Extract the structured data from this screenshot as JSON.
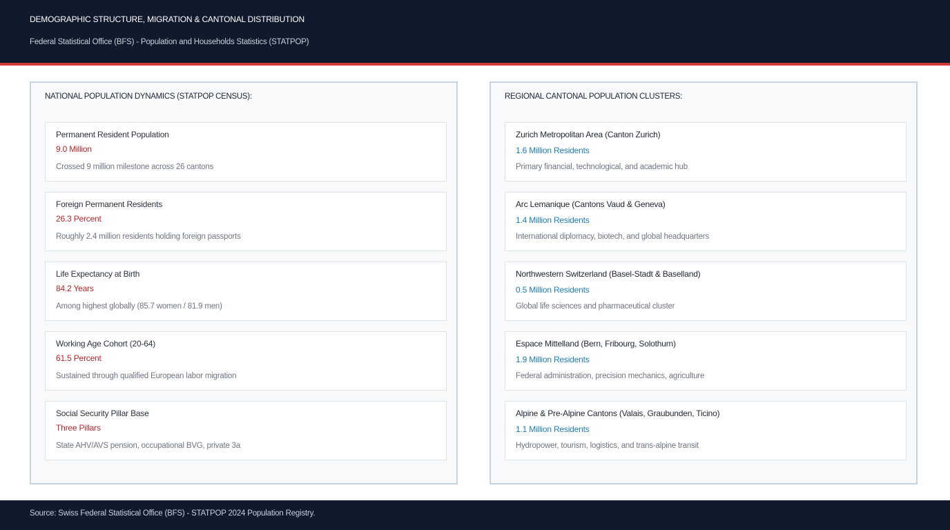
{
  "header": {
    "title": "DEMOGRAPHIC STRUCTURE, MIGRATION & CANTONAL DISTRIBUTION",
    "subtitle": "Federal Statistical Office (BFS) - Population and Households Statistics (STATPOP)"
  },
  "colors": {
    "header_bg": "#111a2c",
    "accent_red": "#d33a3a",
    "national_value": "#b4262c",
    "regional_value": "#1f7bb0"
  },
  "national": {
    "title": "NATIONAL POPULATION DYNAMICS (STATPOP CENSUS):",
    "cards": [
      {
        "label": "Permanent Resident Population",
        "value": "9.0 Million",
        "desc": "Crossed 9 million milestone across 26 cantons"
      },
      {
        "label": "Foreign Permanent Residents",
        "value": "26.3 Percent",
        "desc": "Roughly 2.4 million residents holding foreign passports"
      },
      {
        "label": "Life Expectancy at Birth",
        "value": "84.2 Years",
        "desc": "Among highest globally (85.7 women / 81.9 men)"
      },
      {
        "label": "Working Age Cohort (20-64)",
        "value": "61.5 Percent",
        "desc": "Sustained through qualified European labor migration"
      },
      {
        "label": "Social Security Pillar Base",
        "value": "Three Pillars",
        "desc": "State AHV/AVS pension, occupational BVG, private 3a"
      }
    ]
  },
  "regional": {
    "title": "REGIONAL CANTONAL POPULATION CLUSTERS:",
    "cards": [
      {
        "label": "Zurich Metropolitan Area (Canton Zurich)",
        "value": "1.6 Million Residents",
        "desc": "Primary financial, technological, and academic hub"
      },
      {
        "label": "Arc Lemanique (Cantons Vaud & Geneva)",
        "value": "1.4 Million Residents",
        "desc": "International diplomacy, biotech, and global headquarters"
      },
      {
        "label": "Northwestern Switzerland (Basel-Stadt & Baselland)",
        "value": "0.5 Million Residents",
        "desc": "Global life sciences and pharmaceutical cluster"
      },
      {
        "label": "Espace Mittelland (Bern, Fribourg, Solothurn)",
        "value": "1.9 Million Residents",
        "desc": "Federal administration, precision mechanics, agriculture"
      },
      {
        "label": "Alpine & Pre-Alpine Cantons (Valais, Graubunden, Ticino)",
        "value": "1.1 Million Residents",
        "desc": "Hydropower, tourism, logistics, and trans-alpine transit"
      }
    ]
  },
  "footer": {
    "source": "Source: Swiss Federal Statistical Office (BFS) - STATPOP 2024 Population Registry."
  }
}
